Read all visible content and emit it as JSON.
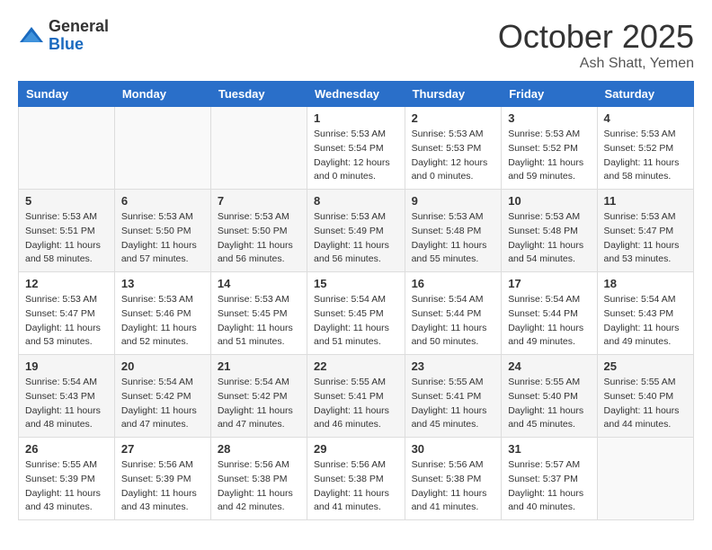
{
  "header": {
    "logo_general": "General",
    "logo_blue": "Blue",
    "month_title": "October 2025",
    "location": "Ash Shatt, Yemen"
  },
  "calendar": {
    "days_of_week": [
      "Sunday",
      "Monday",
      "Tuesday",
      "Wednesday",
      "Thursday",
      "Friday",
      "Saturday"
    ],
    "weeks": [
      [
        {
          "day": "",
          "info": ""
        },
        {
          "day": "",
          "info": ""
        },
        {
          "day": "",
          "info": ""
        },
        {
          "day": "1",
          "info": "Sunrise: 5:53 AM\nSunset: 5:54 PM\nDaylight: 12 hours\nand 0 minutes."
        },
        {
          "day": "2",
          "info": "Sunrise: 5:53 AM\nSunset: 5:53 PM\nDaylight: 12 hours\nand 0 minutes."
        },
        {
          "day": "3",
          "info": "Sunrise: 5:53 AM\nSunset: 5:52 PM\nDaylight: 11 hours\nand 59 minutes."
        },
        {
          "day": "4",
          "info": "Sunrise: 5:53 AM\nSunset: 5:52 PM\nDaylight: 11 hours\nand 58 minutes."
        }
      ],
      [
        {
          "day": "5",
          "info": "Sunrise: 5:53 AM\nSunset: 5:51 PM\nDaylight: 11 hours\nand 58 minutes."
        },
        {
          "day": "6",
          "info": "Sunrise: 5:53 AM\nSunset: 5:50 PM\nDaylight: 11 hours\nand 57 minutes."
        },
        {
          "day": "7",
          "info": "Sunrise: 5:53 AM\nSunset: 5:50 PM\nDaylight: 11 hours\nand 56 minutes."
        },
        {
          "day": "8",
          "info": "Sunrise: 5:53 AM\nSunset: 5:49 PM\nDaylight: 11 hours\nand 56 minutes."
        },
        {
          "day": "9",
          "info": "Sunrise: 5:53 AM\nSunset: 5:48 PM\nDaylight: 11 hours\nand 55 minutes."
        },
        {
          "day": "10",
          "info": "Sunrise: 5:53 AM\nSunset: 5:48 PM\nDaylight: 11 hours\nand 54 minutes."
        },
        {
          "day": "11",
          "info": "Sunrise: 5:53 AM\nSunset: 5:47 PM\nDaylight: 11 hours\nand 53 minutes."
        }
      ],
      [
        {
          "day": "12",
          "info": "Sunrise: 5:53 AM\nSunset: 5:47 PM\nDaylight: 11 hours\nand 53 minutes."
        },
        {
          "day": "13",
          "info": "Sunrise: 5:53 AM\nSunset: 5:46 PM\nDaylight: 11 hours\nand 52 minutes."
        },
        {
          "day": "14",
          "info": "Sunrise: 5:53 AM\nSunset: 5:45 PM\nDaylight: 11 hours\nand 51 minutes."
        },
        {
          "day": "15",
          "info": "Sunrise: 5:54 AM\nSunset: 5:45 PM\nDaylight: 11 hours\nand 51 minutes."
        },
        {
          "day": "16",
          "info": "Sunrise: 5:54 AM\nSunset: 5:44 PM\nDaylight: 11 hours\nand 50 minutes."
        },
        {
          "day": "17",
          "info": "Sunrise: 5:54 AM\nSunset: 5:44 PM\nDaylight: 11 hours\nand 49 minutes."
        },
        {
          "day": "18",
          "info": "Sunrise: 5:54 AM\nSunset: 5:43 PM\nDaylight: 11 hours\nand 49 minutes."
        }
      ],
      [
        {
          "day": "19",
          "info": "Sunrise: 5:54 AM\nSunset: 5:43 PM\nDaylight: 11 hours\nand 48 minutes."
        },
        {
          "day": "20",
          "info": "Sunrise: 5:54 AM\nSunset: 5:42 PM\nDaylight: 11 hours\nand 47 minutes."
        },
        {
          "day": "21",
          "info": "Sunrise: 5:54 AM\nSunset: 5:42 PM\nDaylight: 11 hours\nand 47 minutes."
        },
        {
          "day": "22",
          "info": "Sunrise: 5:55 AM\nSunset: 5:41 PM\nDaylight: 11 hours\nand 46 minutes."
        },
        {
          "day": "23",
          "info": "Sunrise: 5:55 AM\nSunset: 5:41 PM\nDaylight: 11 hours\nand 45 minutes."
        },
        {
          "day": "24",
          "info": "Sunrise: 5:55 AM\nSunset: 5:40 PM\nDaylight: 11 hours\nand 45 minutes."
        },
        {
          "day": "25",
          "info": "Sunrise: 5:55 AM\nSunset: 5:40 PM\nDaylight: 11 hours\nand 44 minutes."
        }
      ],
      [
        {
          "day": "26",
          "info": "Sunrise: 5:55 AM\nSunset: 5:39 PM\nDaylight: 11 hours\nand 43 minutes."
        },
        {
          "day": "27",
          "info": "Sunrise: 5:56 AM\nSunset: 5:39 PM\nDaylight: 11 hours\nand 43 minutes."
        },
        {
          "day": "28",
          "info": "Sunrise: 5:56 AM\nSunset: 5:38 PM\nDaylight: 11 hours\nand 42 minutes."
        },
        {
          "day": "29",
          "info": "Sunrise: 5:56 AM\nSunset: 5:38 PM\nDaylight: 11 hours\nand 41 minutes."
        },
        {
          "day": "30",
          "info": "Sunrise: 5:56 AM\nSunset: 5:38 PM\nDaylight: 11 hours\nand 41 minutes."
        },
        {
          "day": "31",
          "info": "Sunrise: 5:57 AM\nSunset: 5:37 PM\nDaylight: 11 hours\nand 40 minutes."
        },
        {
          "day": "",
          "info": ""
        }
      ]
    ]
  }
}
